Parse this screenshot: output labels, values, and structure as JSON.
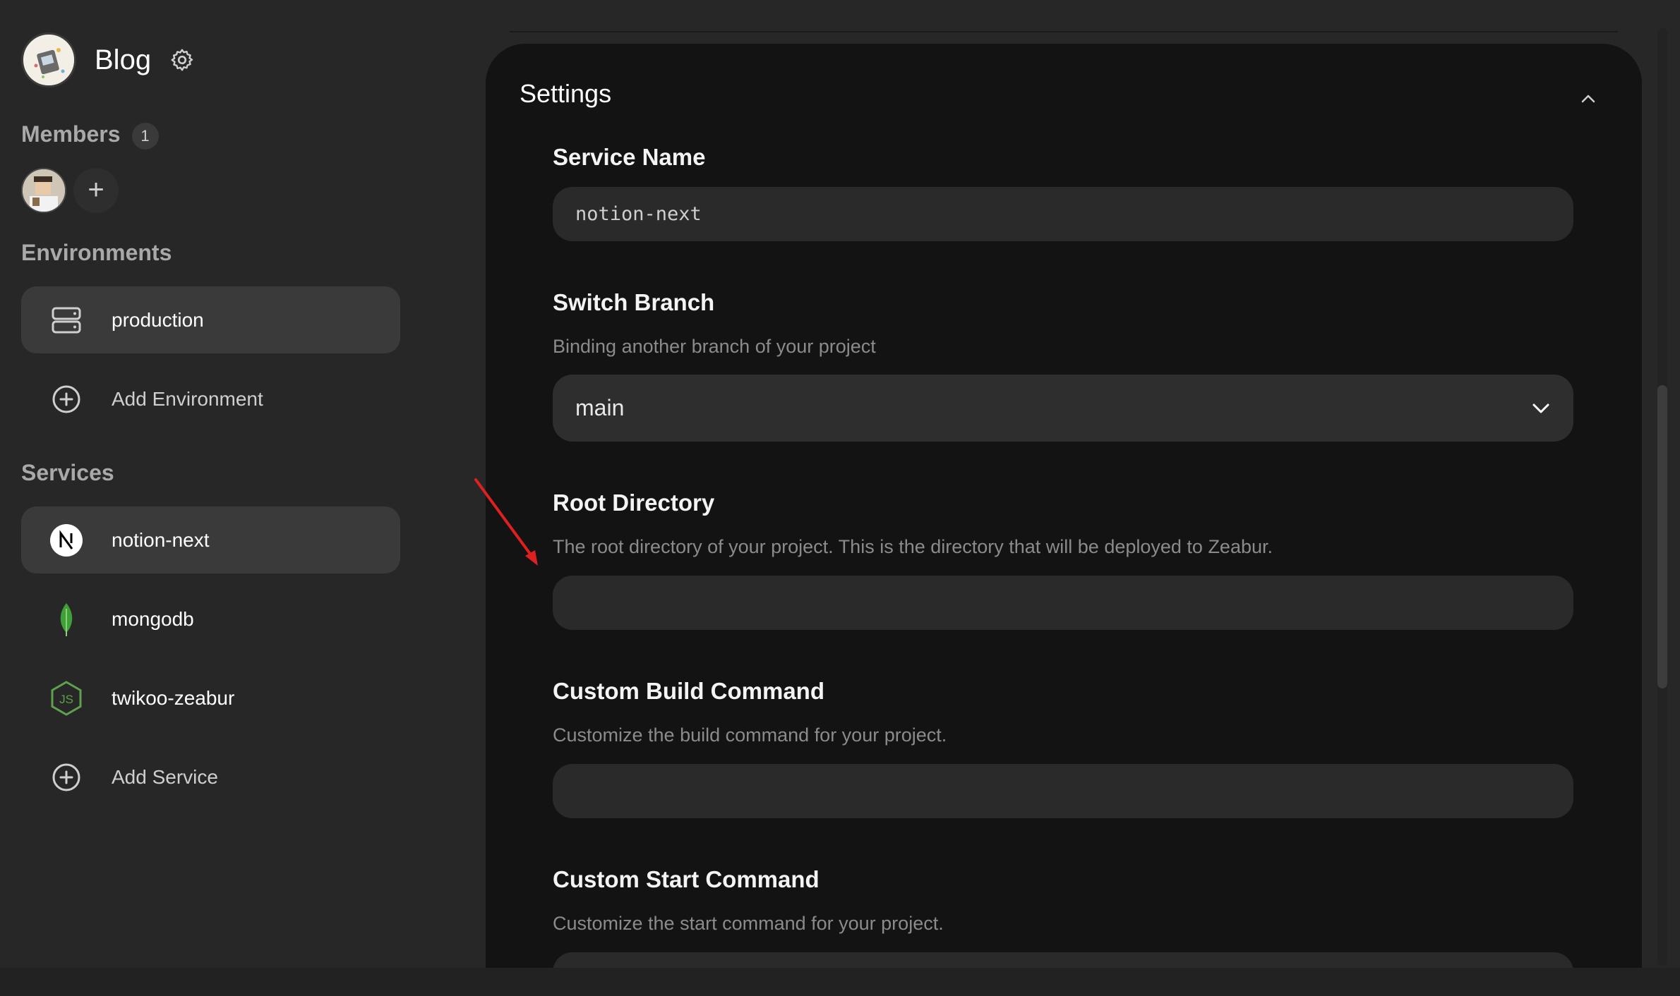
{
  "project": {
    "title": "Blog"
  },
  "members": {
    "label": "Members",
    "count": "1",
    "add_symbol": "+"
  },
  "environments": {
    "label": "Environments",
    "items": [
      {
        "label": "production",
        "icon": "server-icon",
        "active": true
      }
    ],
    "add_label": "Add Environment"
  },
  "services": {
    "label": "Services",
    "items": [
      {
        "label": "notion-next",
        "icon": "nextjs-icon",
        "active": true
      },
      {
        "label": "mongodb",
        "icon": "mongodb-leaf-icon",
        "active": false
      },
      {
        "label": "twikoo-zeabur",
        "icon": "nodejs-icon",
        "active": false
      }
    ],
    "add_label": "Add Service"
  },
  "settings": {
    "title": "Settings",
    "service_name": {
      "label": "Service Name",
      "value": "notion-next"
    },
    "switch_branch": {
      "label": "Switch Branch",
      "description": "Binding another branch of your project",
      "value": "main"
    },
    "root_directory": {
      "label": "Root Directory",
      "description": "The root directory of your project. This is the directory that will be deployed to Zeabur.",
      "value": ""
    },
    "build_command": {
      "label": "Custom Build Command",
      "description": "Customize the build command for your project.",
      "value": ""
    },
    "start_command": {
      "label": "Custom Start Command",
      "description": "Customize the start command for your project.",
      "value": ""
    }
  },
  "colors": {
    "background": "#272727",
    "panel": "#131313",
    "input": "#2a2a2a",
    "active_item": "#3a3a3a",
    "annotation_arrow": "#e02020",
    "mongodb_green": "#3fa037",
    "nodejs_green": "#5fa04e"
  }
}
